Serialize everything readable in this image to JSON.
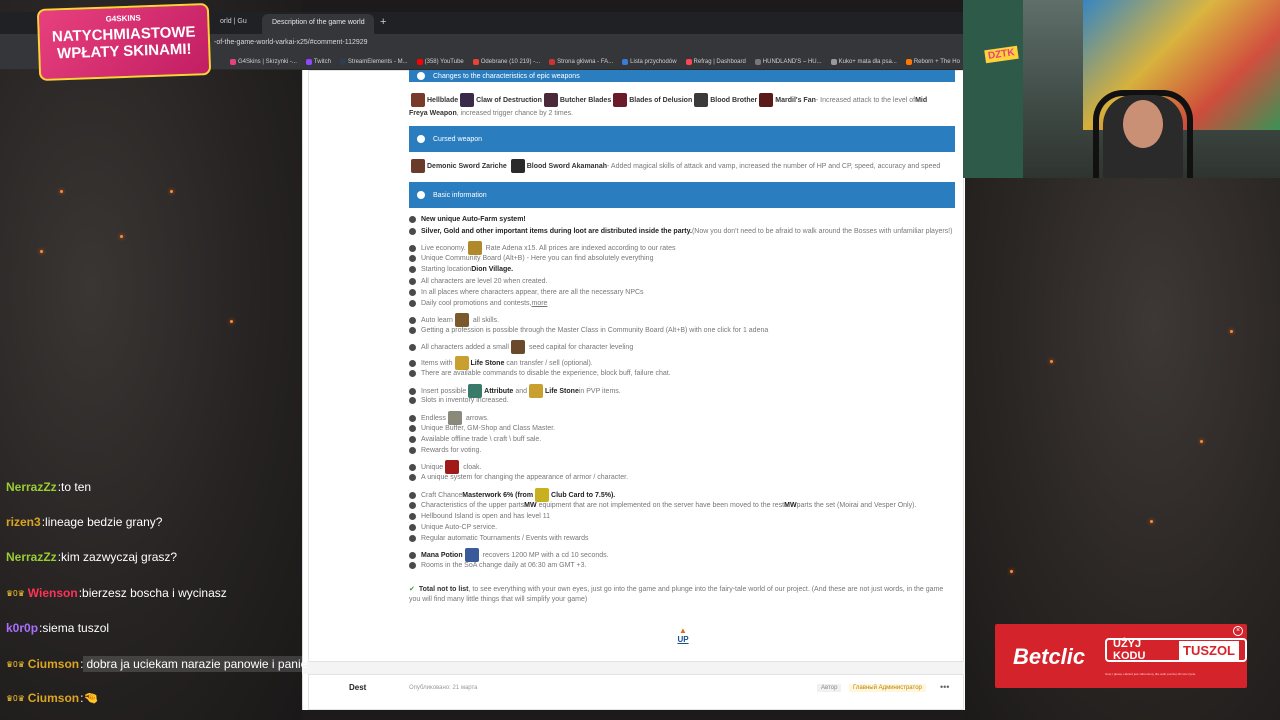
{
  "browser": {
    "tabs": [
      {
        "label": "orld | Gu",
        "active": false
      },
      {
        "label": "Description of the game world",
        "active": true
      }
    ],
    "url": "-of-the-game-world-varkai-x25/#comment-112929",
    "bookmarks": [
      {
        "label": "G4Skins | Skrzynki -...",
        "color": "#e8407e"
      },
      {
        "label": "Twitch",
        "color": "#9146ff"
      },
      {
        "label": "StreamElements - M...",
        "color": "#2c3e50"
      },
      {
        "label": "(358) YouTube",
        "color": "#ff0000"
      },
      {
        "label": "Odebrane (10 219) -...",
        "color": "#ea4335"
      },
      {
        "label": "Strona główna - FA...",
        "color": "#cc3333"
      },
      {
        "label": "Lista przychodów",
        "color": "#3a7bd5"
      },
      {
        "label": "Refrag | Dashboard",
        "color": "#ff4455"
      },
      {
        "label": "HUNDLAND'S – HU...",
        "color": "#777777"
      },
      {
        "label": "Kuko+ mata dla psa...",
        "color": "#999999"
      },
      {
        "label": "Reborn + The Ho",
        "color": "#ff7700"
      }
    ]
  },
  "promo": {
    "brand": "G4SKINS",
    "line1": "NATYCHMIASTOWE",
    "line2": "WPŁATY SKINAMI!"
  },
  "page": {
    "epic_header_partial": "Changes to the characteristics of epic weapons",
    "epic_line": {
      "items": [
        "Hellblade",
        "Claw of Destruction",
        "Butcher Blades",
        "Blades of Delusion",
        "Blood Brother",
        "Mardil's Fan"
      ],
      "suffix": " - Increased attack to the level of ",
      "strong": "Mid",
      "line2_strong": "Freya Weapon",
      "line2_rest": ", increased trigger chance by 2 times."
    },
    "cursed_header": "Cursed weapon",
    "cursed_line": {
      "item1": "Demonic Sword Zariche",
      "item2": "Blood Sword Akamanah",
      "rest": " - Added magical skills of attack and vamp, increased the number of HP and CP, speed, accuracy and speed"
    },
    "basic_header": "Basic information",
    "items": [
      {
        "bold": "New unique Auto-Farm system!",
        "text": ""
      },
      {
        "bold": "Silver, Gold and other important items during loot are distributed inside the party.",
        "text": " (Now you don't need to be afraid to walk around the Bosses with unfamiliar players!)"
      },
      {
        "bold": "",
        "text": "Live economy.",
        "icon": "adena-icon",
        "text2": "Rate Adena x15. All prices are indexed according to our rates"
      },
      {
        "bold": "",
        "text": "Unique Community Board (Alt+B) - Here you can find absolutely everything"
      },
      {
        "bold": "",
        "text": "Starting location ",
        "strong_after": "Dion Village."
      },
      {
        "bold": "",
        "text": "All characters are level 20 when created."
      },
      {
        "bold": "",
        "text": "In all places where characters appear, there are all the necessary NPCs"
      },
      {
        "bold": "",
        "text": "Daily cool promotions and contests, ",
        "link": "more"
      },
      {
        "bold": "",
        "text": "Auto learn",
        "icon": "skill-icon",
        "text2": "all skills."
      },
      {
        "bold": "",
        "text": "Getting a profession is possible through the Master Class in Community Board (Alt+B) with one click for 1 adena"
      },
      {
        "bold": "",
        "text": "All characters added a small",
        "icon": "chest-icon",
        "text2": "seed capital for character leveling"
      },
      {
        "bold": "",
        "text": "Items with",
        "icon": "lifestone-icon",
        "strong_after": "Life Stone",
        "text2": " can transfer / sell (optional)."
      },
      {
        "bold": "",
        "text": "There are available commands to disable the experience, block buff, failure chat."
      },
      {
        "bold": "",
        "text": "Insert possible",
        "icon": "attribute-icon",
        "strong_after": "Attribute",
        "text2": " and ",
        "icon2": "lifestone-icon",
        "strong_after2": "Life Stone",
        "text3": " in PVP items."
      },
      {
        "bold": "",
        "text": "Slots in inventory increased."
      },
      {
        "bold": "",
        "text": "Endless",
        "icon": "arrows-icon",
        "text2": "arrows."
      },
      {
        "bold": "",
        "text": "Unique Buffer, GM-Shop and Class Master."
      },
      {
        "bold": "",
        "text": "Available offline trade \\ craft \\ buff sale."
      },
      {
        "bold": "",
        "text": "Rewards for voting."
      },
      {
        "bold": "",
        "text": "Unique",
        "icon": "cloak-icon",
        "text2": "cloak."
      },
      {
        "bold": "",
        "text": "A unique system for changing the appearance of armor / character."
      },
      {
        "bold": "",
        "text": "Craft Chance ",
        "strong_after": "Masterwork 6% (from",
        "icon": "card-icon",
        "strong_after2": "Club Card to 7.5%)."
      },
      {
        "bold": "",
        "text": "Characteristics of the upper parts ",
        "strong_after": "MW",
        "text2": " equipment that are not implemented on the server have been moved to the rest ",
        "strong_after2": "MW",
        "text3": " parts the set (Moirai and Vesper Only)."
      },
      {
        "bold": "",
        "text": "Hellbound Island is open and has level 11"
      },
      {
        "bold": "",
        "text": "Unique Auto-CP service."
      },
      {
        "bold": "",
        "text": "Regular automatic Tournaments / Events with rewards"
      },
      {
        "bold": "Mana Potion",
        "text": "",
        "icon": "mana-icon",
        "text2": "recovers 1200 MP with a cd 10 seconds."
      },
      {
        "bold": "",
        "text": "Rooms in the SoA change daily at 06:30 am GMT +3."
      }
    ],
    "total_bold": "Total not to list",
    "total_text": ", to see everything with your own eyes, just go into the game and plunge into the fairy-tale world of our project. (And these are not just words, in the game",
    "total_text2": "you will find many little things that will simplify your game)",
    "up_label": "UP",
    "next_post": {
      "author": "Dest",
      "date": "Опубликовано: 21 марта",
      "badge1": "Автор",
      "badge2": "Главный Администратор",
      "menu": "•••"
    }
  },
  "chat": [
    {
      "name": "NerrazZz",
      "color": "#9acd32",
      "badge": "",
      "text": "to ten"
    },
    {
      "name": "rizen3",
      "color": "#daa520",
      "badge": "",
      "text": "lineage bedzie grany?"
    },
    {
      "name": "NerrazZz",
      "color": "#9acd32",
      "badge": "",
      "text": "kim zazwyczaj grasz?"
    },
    {
      "name": "Wienson",
      "color": "#ff3355",
      "badge": "♛0♛",
      "text": "bierzesz boscha i wycinasz"
    },
    {
      "name": "k0r0p",
      "color": "#a970ff",
      "badge": "",
      "text": "siema tuszol"
    },
    {
      "name": "Ciumson",
      "color": "#daa520",
      "badge": "♛0♛",
      "text": "dobra ja uciekam narazie panowie i panie"
    },
    {
      "name": "Ciumson",
      "color": "#daa520",
      "badge": "♛0♛",
      "text": "🤏"
    }
  ],
  "webcam": {
    "sticker": "DZTK"
  },
  "ad": {
    "brand": "Betclic",
    "code_label": "UŻYJ KODU",
    "code": "TUSZOL",
    "close": "×",
    "fine": "Graj z głową. Hazard jest zabroniony dla osób poniżej 18 roku życia."
  }
}
